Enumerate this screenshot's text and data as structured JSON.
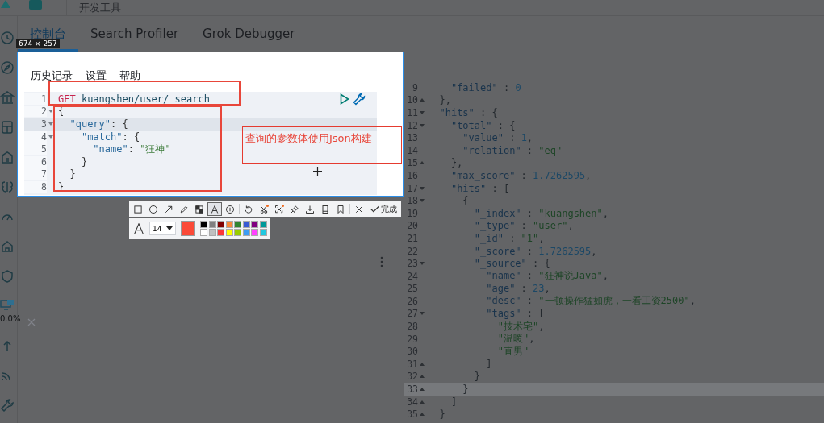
{
  "header": {
    "title": "开发工具"
  },
  "tabs": [
    {
      "label": "控制台",
      "selected": true
    },
    {
      "label": "Search Profiler",
      "selected": false
    },
    {
      "label": "Grok Debugger",
      "selected": false
    }
  ],
  "sidebar": {
    "status": "0.0%"
  },
  "capture": {
    "size": "674 × 257",
    "menu": [
      "历史记录",
      "设置",
      "帮助"
    ],
    "editor": {
      "lines": [
        {
          "num": "1",
          "text": "GET kuangshen/user/_search",
          "kind": "request",
          "active": false
        },
        {
          "num": "2",
          "text": "{",
          "kind": "open",
          "active": false
        },
        {
          "num": "3",
          "text": "  \"query\": {",
          "kind": "open",
          "active": true
        },
        {
          "num": "4",
          "text": "    \"match\": {",
          "kind": "open",
          "active": false
        },
        {
          "num": "5",
          "text": "      \"name\": \"狂神\"",
          "kind": "plain",
          "active": false
        },
        {
          "num": "6",
          "text": "    }",
          "kind": "plain",
          "active": false
        },
        {
          "num": "7",
          "text": "  }",
          "kind": "plain",
          "active": false
        },
        {
          "num": "8",
          "text": "}",
          "kind": "plain",
          "active": false
        }
      ]
    },
    "annotations": [
      {
        "kind": "rectangle"
      },
      {
        "kind": "rectangle"
      },
      {
        "kind": "text",
        "text": "查询的参数体使用Json构建"
      }
    ]
  },
  "annotation_toolbar": {
    "tools": [
      {
        "kind": "rectangle",
        "selected": false
      },
      {
        "kind": "ellipse",
        "selected": false
      },
      {
        "kind": "arrow",
        "selected": false
      },
      {
        "kind": "pencil",
        "selected": false
      },
      {
        "kind": "mosaic",
        "selected": false
      },
      {
        "kind": "text",
        "selected": true
      },
      {
        "kind": "number",
        "selected": false
      },
      {
        "kind": "undo",
        "selected": false
      },
      {
        "kind": "scissors",
        "selected": false
      },
      {
        "kind": "crop",
        "selected": false
      },
      {
        "kind": "pin",
        "selected": false
      },
      {
        "kind": "download",
        "selected": false
      },
      {
        "kind": "phone",
        "selected": false
      },
      {
        "kind": "bookmark",
        "selected": false
      },
      {
        "kind": "close",
        "selected": false
      },
      {
        "kind": "done",
        "label": "完成",
        "selected": false
      }
    ]
  },
  "text_style": {
    "font_size": "14",
    "color": "#fb4a38",
    "palette": [
      {
        "color": "#000000"
      },
      {
        "color": "#808080"
      },
      {
        "color": "#800000"
      },
      {
        "color": "#f7883a"
      },
      {
        "color": "#308430"
      },
      {
        "color": "#385ad3"
      },
      {
        "color": "#800080"
      },
      {
        "color": "#009999"
      },
      {
        "color": "#ffffff"
      },
      {
        "color": "#c0c0c0"
      },
      {
        "color": "#fb3838"
      },
      {
        "color": "#ffff00"
      },
      {
        "color": "#99cc00"
      },
      {
        "color": "#3d9df3"
      },
      {
        "color": "#ff40ff"
      },
      {
        "color": "#1ec8e0"
      }
    ]
  },
  "output": {
    "lines": [
      {
        "num": "9",
        "text": "    \"failed\" : 0",
        "kind": "plain",
        "active": false
      },
      {
        "num": "10",
        "text": "  },",
        "kind": "close",
        "active": false
      },
      {
        "num": "11",
        "text": "  \"hits\" : {",
        "kind": "open",
        "active": false
      },
      {
        "num": "12",
        "text": "    \"total\" : {",
        "kind": "open",
        "active": false
      },
      {
        "num": "13",
        "text": "      \"value\" : 1,",
        "kind": "plain",
        "active": false
      },
      {
        "num": "14",
        "text": "      \"relation\" : \"eq\"",
        "kind": "plain",
        "active": false
      },
      {
        "num": "15",
        "text": "    },",
        "kind": "close",
        "active": false
      },
      {
        "num": "16",
        "text": "    \"max_score\" : 1.7262595,",
        "kind": "plain",
        "active": false
      },
      {
        "num": "17",
        "text": "    \"hits\" : [",
        "kind": "open",
        "active": false
      },
      {
        "num": "18",
        "text": "      {",
        "kind": "open",
        "active": false
      },
      {
        "num": "19",
        "text": "        \"_index\" : \"kuangshen\",",
        "kind": "plain",
        "active": false
      },
      {
        "num": "20",
        "text": "        \"_type\" : \"user\",",
        "kind": "plain",
        "active": false
      },
      {
        "num": "21",
        "text": "        \"_id\" : \"1\",",
        "kind": "plain",
        "active": false
      },
      {
        "num": "22",
        "text": "        \"_score\" : 1.7262595,",
        "kind": "plain",
        "active": false
      },
      {
        "num": "23",
        "text": "        \"_source\" : {",
        "kind": "open",
        "active": false
      },
      {
        "num": "24",
        "text": "          \"name\" : \"狂神说Java\",",
        "kind": "plain",
        "active": false
      },
      {
        "num": "25",
        "text": "          \"age\" : 23,",
        "kind": "plain",
        "active": false
      },
      {
        "num": "26",
        "text": "          \"desc\" : \"一顿操作猛如虎，一看工资2500\",",
        "kind": "plain",
        "active": false
      },
      {
        "num": "27",
        "text": "          \"tags\" : [",
        "kind": "open",
        "active": false
      },
      {
        "num": "28",
        "text": "            \"技术宅\",",
        "kind": "plain",
        "active": false
      },
      {
        "num": "29",
        "text": "            \"温暖\",",
        "kind": "plain",
        "active": false
      },
      {
        "num": "30",
        "text": "            \"直男\"",
        "kind": "plain",
        "active": false
      },
      {
        "num": "31",
        "text": "          ]",
        "kind": "close",
        "active": false
      },
      {
        "num": "32",
        "text": "        }",
        "kind": "close",
        "active": false
      },
      {
        "num": "33",
        "text": "      }",
        "kind": "close",
        "active": true
      },
      {
        "num": "34",
        "text": "    ]",
        "kind": "close",
        "active": false
      },
      {
        "num": "35",
        "text": "  }",
        "kind": "close",
        "active": false
      }
    ]
  }
}
